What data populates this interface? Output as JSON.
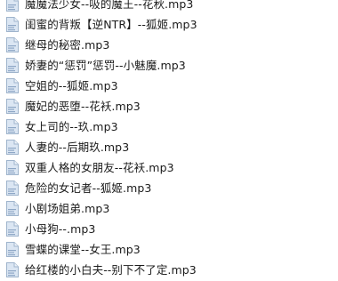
{
  "colors": {
    "background": "#ffffff",
    "text": "#1a1a1a",
    "icon_body": "#dbe6f3",
    "icon_border": "#9fb4cc",
    "icon_fold": "#eef3fa",
    "icon_lines": "#8ea7c6"
  },
  "file_icon": "audio-file-icon",
  "files": [
    {
      "name": "魔魔法少女--吸的魔王--花秋.mp3"
    },
    {
      "name": "闺蜜的背叛【逆NTR】--狐姬.mp3"
    },
    {
      "name": "继母的秘密.mp3"
    },
    {
      "name": "娇妻的“惩罚”惩罚--小魅魔.mp3"
    },
    {
      "name": "空姐的--狐姬.mp3"
    },
    {
      "name": "魔妃的恶堕--花袄.mp3"
    },
    {
      "name": "女上司的--玖.mp3"
    },
    {
      "name": "人妻的--后期玖.mp3"
    },
    {
      "name": "双重人格的女朋友--花袄.mp3"
    },
    {
      "name": "危险的女记者--狐姬.mp3"
    },
    {
      "name": "小剧场姐弟.mp3"
    },
    {
      "name": "小母狗--.mp3"
    },
    {
      "name": "雪蝶的课堂--女王.mp3"
    },
    {
      "name": "给红楼的小白夫--别下不了定.mp3"
    }
  ]
}
